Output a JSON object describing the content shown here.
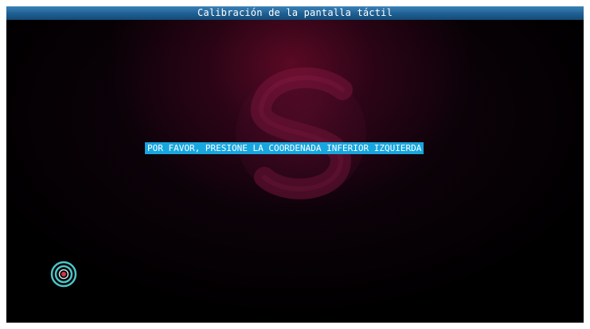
{
  "window": {
    "title": "Calibración de la pantalla táctil"
  },
  "calibration": {
    "instruction": "POR FAVOR, PRESIONE LA COORDENADA INFERIOR IZQUIERDA",
    "target_icon": "crosshair-target-icon",
    "background_logo_icon": "s-logo-icon"
  },
  "colors": {
    "title_bar": "#2a6ea6",
    "highlight": "#18a6df",
    "target_ring": "#4fc3c8",
    "target_center": "#d0364a",
    "background": "#000000"
  }
}
